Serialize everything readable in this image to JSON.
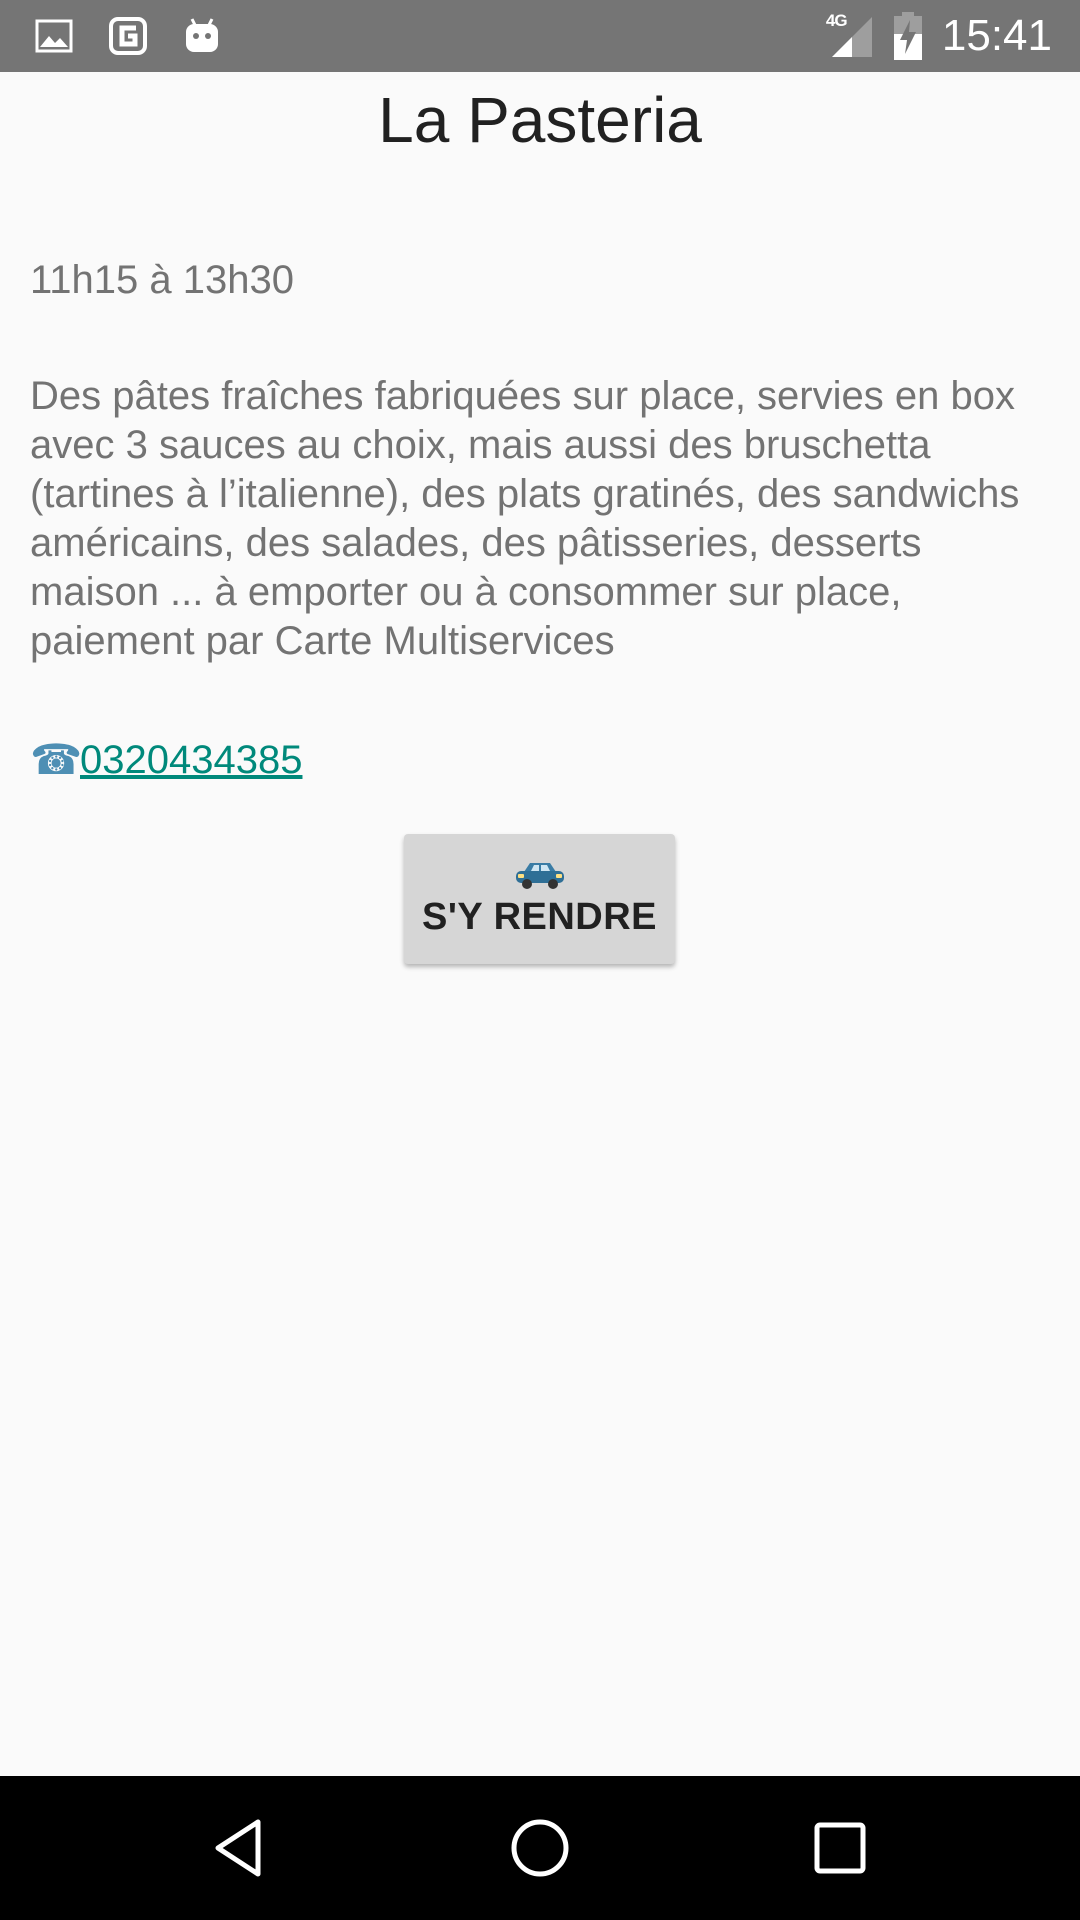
{
  "status_bar": {
    "time": "15:41",
    "network": "4G",
    "icons": [
      "image-icon",
      "g-app-icon",
      "android-icon",
      "signal-icon",
      "battery-charging-icon"
    ]
  },
  "page": {
    "title": "La Pasteria",
    "hours": "11h15 à 13h30",
    "description": "Des pâtes fraîches fabriquées sur place, servies en box avec 3 sauces au choix, mais aussi des bruschetta (tartines à l’italienne), des plats gratinés, des sandwichs américains, des salades, des pâtisseries, desserts maison ... à emporter ou à consommer sur place, paiement par Carte Multiservices",
    "phone_icon": "☎",
    "phone": "0320434385",
    "directions_button": {
      "icon": "car-icon",
      "label": "S'Y RENDRE"
    }
  },
  "nav_bar": {
    "buttons": [
      "back-icon",
      "home-icon",
      "recents-icon"
    ]
  },
  "colors": {
    "status_bar": "#757575",
    "background": "#fafafa",
    "link": "#00897b",
    "button": "#d6d6d6",
    "nav_bar": "#000000"
  }
}
